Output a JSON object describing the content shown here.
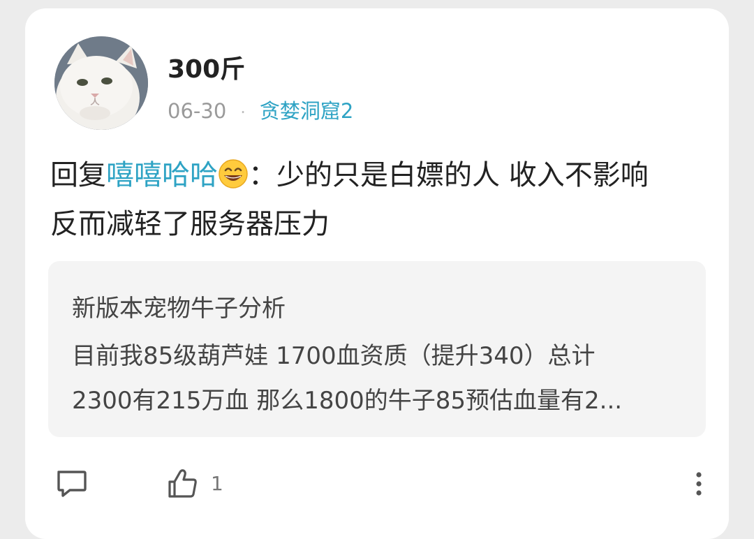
{
  "post": {
    "author": "300斤",
    "date": "06-30",
    "separator": "·",
    "forum": "贪婪洞窟2",
    "reply_prefix": "回复",
    "mention": "嘻嘻哈哈",
    "mention_emoji": "grinning-face-emoji",
    "reply_text_line1": "：少的只是白嫖的人 收入不影响",
    "reply_text_line2": "反而减轻了服务器压力"
  },
  "quote": {
    "title": "新版本宠物牛子分析",
    "line1": "目前我85级葫芦娃 1700血资质（提升340）总计",
    "line2": "2300有215万血 那么1800的牛子85预估血量有2..."
  },
  "actions": {
    "comment_icon": "comment-icon",
    "like_icon": "thumbs-up-icon",
    "like_count": "1",
    "more_icon": "more-vertical-icon"
  },
  "colors": {
    "accent": "#2ea3c4",
    "background": "#ececec",
    "card": "#ffffff",
    "quote_bg": "#f4f4f4"
  }
}
